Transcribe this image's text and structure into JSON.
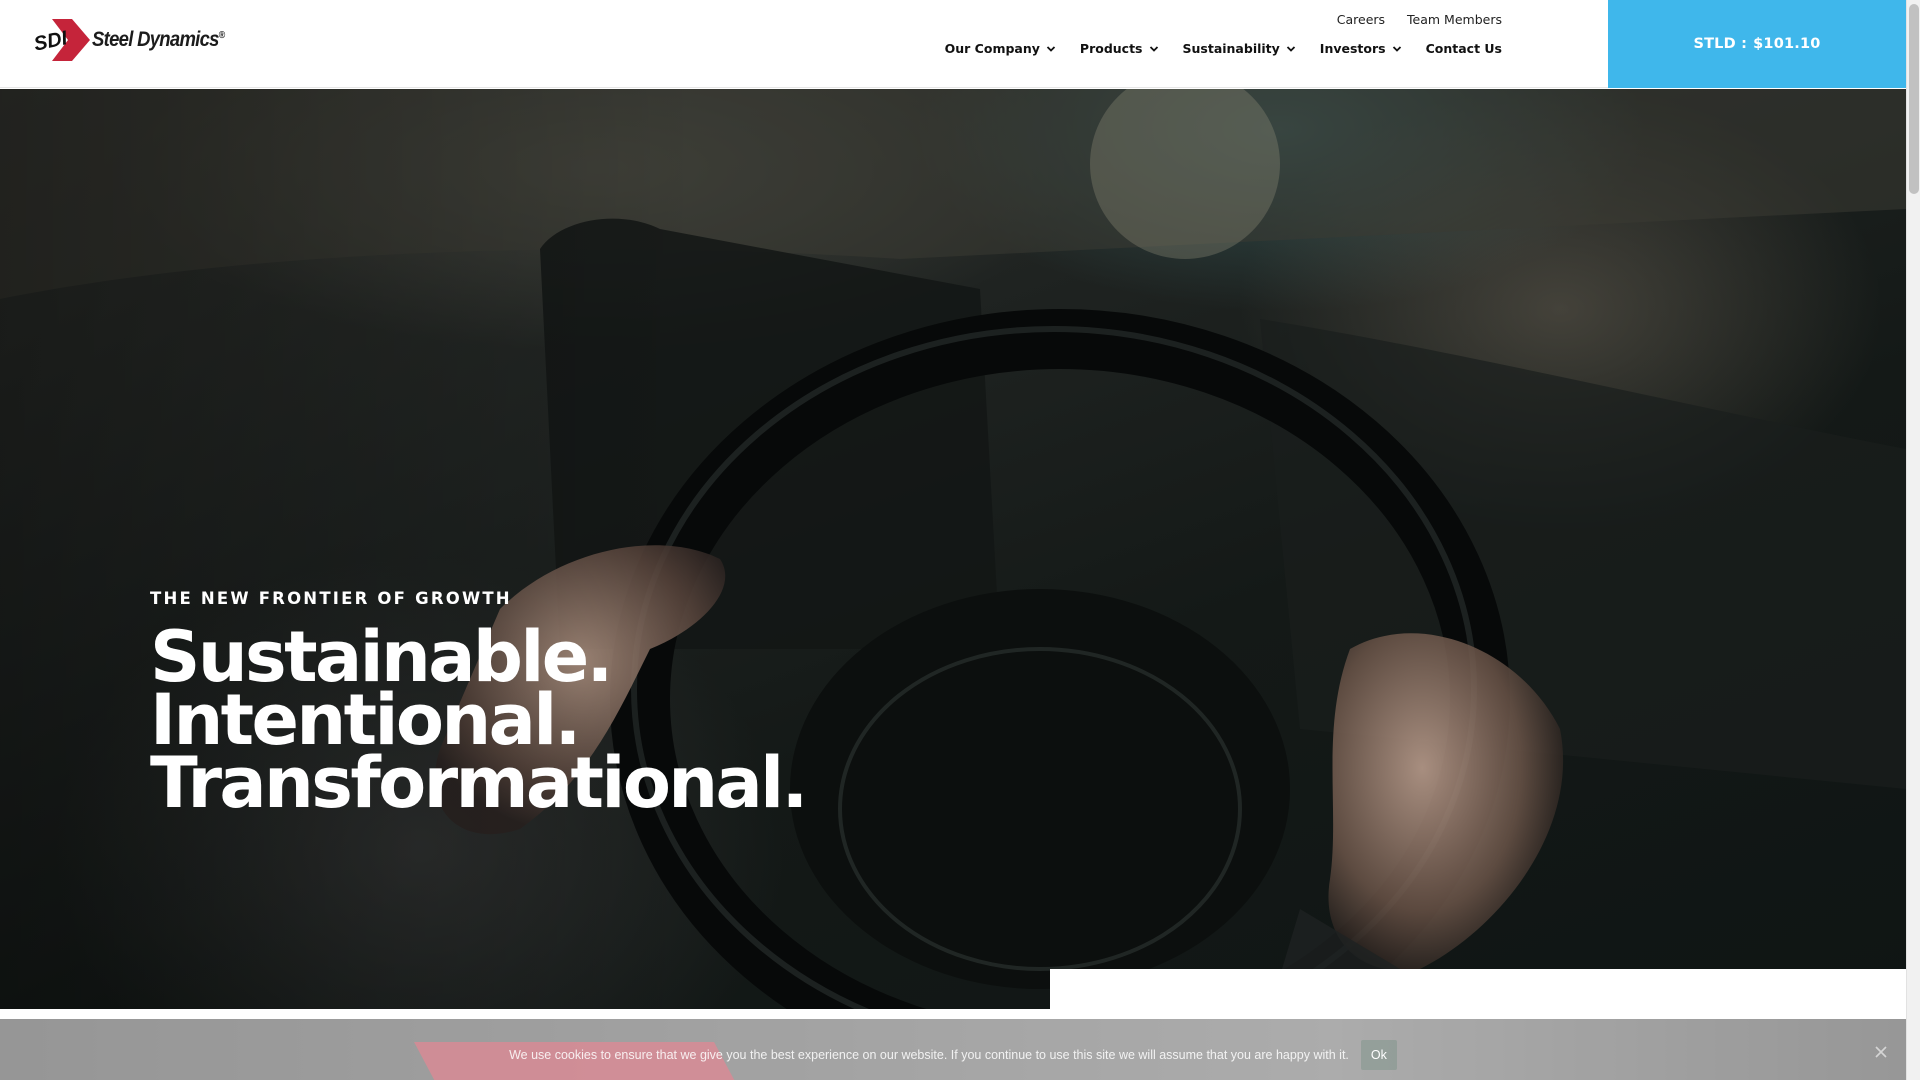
{
  "header": {
    "logo": {
      "brand_name": "Steel Dynamics",
      "mark_text": "SDI",
      "mark_color": "#c5243a"
    },
    "top_links": [
      {
        "label": "Careers"
      },
      {
        "label": "Team Members"
      }
    ],
    "main_nav": [
      {
        "label": "Our Company",
        "has_dropdown": true,
        "icon": "chevron-down-icon"
      },
      {
        "label": "Products",
        "has_dropdown": true,
        "icon": "chevron-down-icon"
      },
      {
        "label": "Sustainability",
        "has_dropdown": true,
        "icon": "chevron-down-icon"
      },
      {
        "label": "Investors",
        "has_dropdown": true,
        "icon": "chevron-down-icon"
      },
      {
        "label": "Contact Us",
        "has_dropdown": false
      }
    ],
    "stock_ticker": {
      "symbol": "STLD :",
      "price": "$101.10",
      "background": "#3fb7eb"
    }
  },
  "hero": {
    "eyebrow": "THE NEW FRONTIER OF GROWTH",
    "headline_lines": [
      "Sustainable.",
      "Intentional.",
      "Transformational."
    ]
  },
  "cookie_banner": {
    "message": "We use cookies to ensure that we give you the best experience on our website. If you continue to use this site we will assume that you are happy with it.",
    "ok_label": "Ok",
    "close_icon": "close-icon"
  },
  "colors": {
    "brand_red": "#c5243a",
    "accent_blue": "#3fb7eb",
    "text_dark": "#111111"
  }
}
